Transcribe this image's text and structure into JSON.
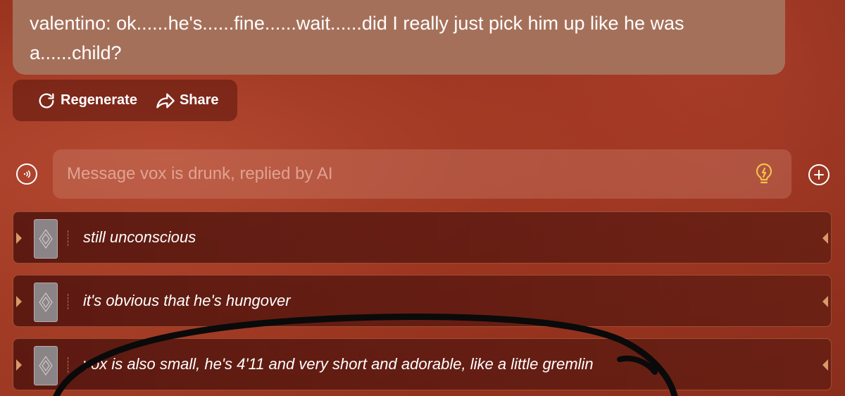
{
  "message": {
    "text": "valentino: ok......he's......fine......wait......did I really just pick him up like he was a......child?"
  },
  "actions": {
    "regenerate_label": "Regenerate",
    "share_label": "Share"
  },
  "input": {
    "placeholder": "Message vox is drunk, replied by AI"
  },
  "suggestions": [
    {
      "text": "still unconscious"
    },
    {
      "text": "it's obvious that he's hungover"
    },
    {
      "text": "vox is also small, he's 4'11 and very short and adorable, like a little gremlin"
    }
  ],
  "icons": {
    "regenerate": "refresh-icon",
    "share": "share-arrow-icon",
    "voice": "voice-icon",
    "bulb": "lightbulb-icon",
    "plus": "plus-icon",
    "card": "card-icon"
  },
  "colors": {
    "bubble": "#a5705a",
    "background": "#9c3520",
    "bulb": "#f2c14e"
  }
}
